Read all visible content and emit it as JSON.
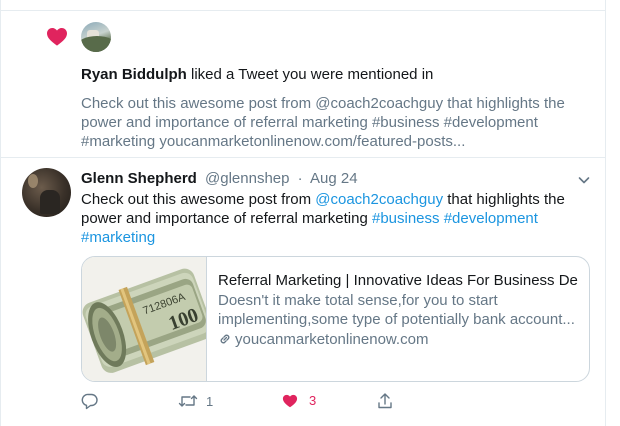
{
  "notification": {
    "actor_name": "Ryan Biddulph",
    "action_text": "liked a Tweet you were mentioned in",
    "preview_text": "Check out this awesome post from @coach2coachguy that highlights the power and importance of referral marketing #business #development #marketing youcanmarketonlinenow.com/featured-posts..."
  },
  "tweet": {
    "author_name": "Glenn Shepherd",
    "author_handle": "@glennshep",
    "separator": "·",
    "date": "Aug 24",
    "text_before": "Check out this awesome post from ",
    "mention": "@coach2coachguy",
    "text_after": " that highlights the power and importance of referral marketing ",
    "hashtag_business": "#business",
    "hashtag_development": "#development",
    "hashtag_marketing": "#marketing",
    "card": {
      "title": "Referral Marketing | Innovative Ideas For Business De...",
      "description": "Doesn't it make total sense,for you to start implementing,some type of potentially bank account...",
      "url": "youcanmarketonlinenow.com",
      "banknote_serial": "712806A",
      "banknote_value": "100"
    },
    "actions": {
      "retweet_count": "1",
      "like_count": "3"
    }
  },
  "colors": {
    "like_red": "#e0245e",
    "link_blue": "#1b95e0",
    "secondary_text": "#657786",
    "border": "#ccd6dd"
  }
}
